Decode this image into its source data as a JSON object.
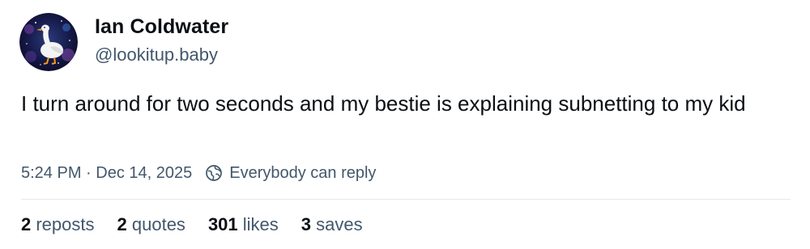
{
  "author": {
    "display_name": "Ian Coldwater",
    "handle": "@lookitup.baby",
    "avatar_icon": "goose-avatar-icon"
  },
  "post": {
    "text": "I turn around for two seconds and my bestie is explaining subnetting to my kid"
  },
  "meta": {
    "timestamp": "5:24 PM · Dec 14, 2025",
    "reply_setting": "Everybody can reply",
    "reply_icon": "globe-icon"
  },
  "stats": {
    "reposts_count": "2",
    "reposts_label": "reposts",
    "quotes_count": "2",
    "quotes_label": "quotes",
    "likes_count": "301",
    "likes_label": "likes",
    "saves_count": "3",
    "saves_label": "saves"
  },
  "colors": {
    "text_primary": "#0b0f14",
    "text_secondary": "#42576c",
    "divider": "#e5e9ee",
    "avatar_bg": "#0e0c2e"
  }
}
